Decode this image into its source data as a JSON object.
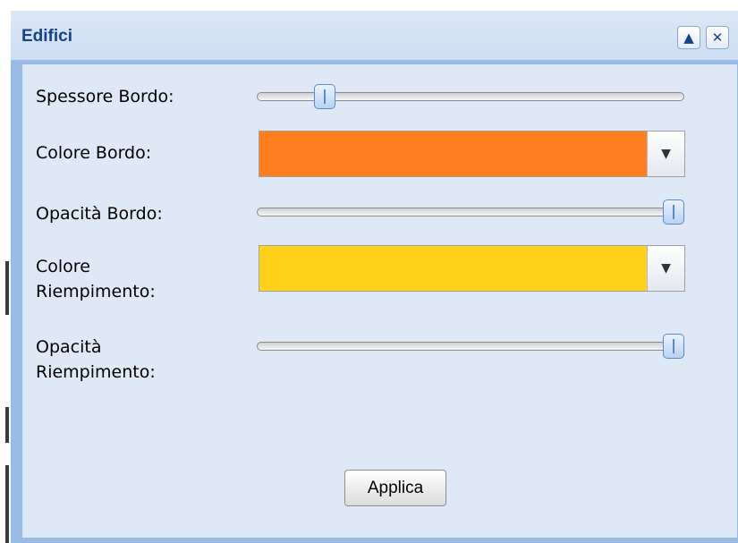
{
  "window": {
    "title": "Edifici",
    "tools": [
      {
        "icon": "collapse-up-icon",
        "glyph": "▲"
      },
      {
        "icon": "close-icon",
        "glyph": "✕"
      }
    ]
  },
  "form": {
    "spessore_bordo": {
      "label": "Spessore Bordo:",
      "slider_value_fraction": 0.14
    },
    "colore_bordo": {
      "label": "Colore Bordo:",
      "color": "#FF7F1E",
      "trigger_icon": "chevron-down-icon",
      "trigger_glyph": "▼"
    },
    "opacita_bordo": {
      "label": "Opacità Bordo:",
      "slider_value_fraction": 1.0
    },
    "colore_riempimento": {
      "label_line1": "Colore",
      "label_line2": "Riempimento:",
      "color": "#FFD11A",
      "trigger_icon": "chevron-down-icon",
      "trigger_glyph": "▼"
    },
    "opacita_riempimento": {
      "label_line1": "Opacità",
      "label_line2": "Riempimento:",
      "slider_value_fraction": 1.0
    }
  },
  "actions": {
    "apply_label": "Applica"
  },
  "theme": {
    "header_text_color": "#15428B",
    "body_background": "#DFE8F6",
    "border_color": "#99BBE8"
  }
}
